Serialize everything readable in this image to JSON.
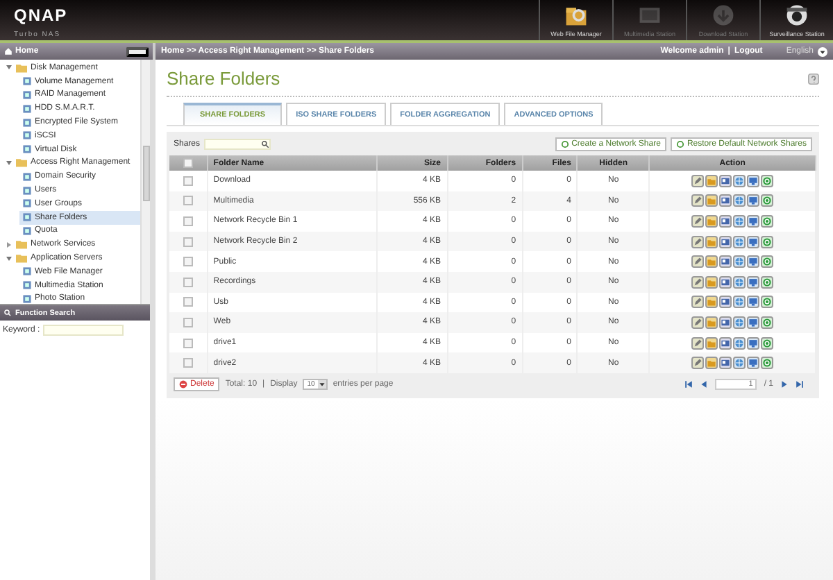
{
  "header": {
    "logo": "QNAP",
    "subtitle": "Turbo NAS",
    "apps": [
      {
        "label": "Web File Manager",
        "kind": "files",
        "disabled": false
      },
      {
        "label": "Multimedia Station",
        "kind": "media",
        "disabled": true
      },
      {
        "label": "Download Station",
        "kind": "download",
        "disabled": true
      },
      {
        "label": "Surveillance Station",
        "kind": "camera",
        "disabled": false
      }
    ]
  },
  "sidebar": {
    "title": "Home",
    "tree": [
      {
        "label": "Disk Management",
        "expanded": true,
        "selected": false,
        "children": [
          {
            "label": "Volume Management",
            "selected": false
          },
          {
            "label": "RAID Management",
            "selected": false
          },
          {
            "label": "HDD S.M.A.R.T.",
            "selected": false
          },
          {
            "label": "Encrypted File System",
            "selected": false
          },
          {
            "label": "iSCSI",
            "selected": false
          },
          {
            "label": "Virtual Disk",
            "selected": false
          }
        ]
      },
      {
        "label": "Access Right Management",
        "expanded": true,
        "selected": false,
        "children": [
          {
            "label": "Domain Security",
            "selected": false
          },
          {
            "label": "Users",
            "selected": false
          },
          {
            "label": "User Groups",
            "selected": false
          },
          {
            "label": "Share Folders",
            "selected": true
          },
          {
            "label": "Quota",
            "selected": false
          }
        ]
      },
      {
        "label": "Network Services",
        "expanded": false,
        "selected": false
      },
      {
        "label": "Application Servers",
        "expanded": true,
        "selected": false,
        "children": [
          {
            "label": "Web File Manager",
            "selected": false
          },
          {
            "label": "Multimedia Station",
            "selected": false
          },
          {
            "label": "Photo Station",
            "selected": false
          }
        ]
      }
    ],
    "search_title": "Function Search",
    "keyword_label": "Keyword :"
  },
  "breadcrumb": "Home >> Access Right Management >> Share Folders",
  "welcome": "Welcome admin",
  "user_separator": "|",
  "logout": "Logout",
  "language": "English",
  "page_title": "Share Folders",
  "tabs": [
    {
      "label": "SHARE FOLDERS",
      "selected": true
    },
    {
      "label": "ISO SHARE FOLDERS",
      "selected": false
    },
    {
      "label": "FOLDER AGGREGATION",
      "selected": false
    },
    {
      "label": "ADVANCED OPTIONS",
      "selected": false
    }
  ],
  "toolbar": {
    "search_label": "Shares",
    "buttons": [
      "Create a Network Share",
      "Restore Default Network Shares"
    ]
  },
  "table": {
    "select_all_checked": false,
    "columns": [
      "Folder Name",
      "Size",
      "Folders",
      "Files",
      "Hidden",
      "Action"
    ],
    "rows": [
      {
        "checked": false,
        "cells": [
          "Download",
          "4 KB",
          "0",
          "0",
          "No"
        ]
      },
      {
        "checked": false,
        "cells": [
          "Multimedia",
          "556 KB",
          "2",
          "4",
          "No"
        ]
      },
      {
        "checked": false,
        "cells": [
          "Network Recycle Bin 1",
          "4 KB",
          "0",
          "0",
          "No"
        ]
      },
      {
        "checked": false,
        "cells": [
          "Network Recycle Bin 2",
          "4 KB",
          "0",
          "0",
          "No"
        ]
      },
      {
        "checked": false,
        "cells": [
          "Public",
          "4 KB",
          "0",
          "0",
          "No"
        ]
      },
      {
        "checked": false,
        "cells": [
          "Recordings",
          "4 KB",
          "0",
          "0",
          "No"
        ]
      },
      {
        "checked": false,
        "cells": [
          "Usb",
          "4 KB",
          "0",
          "0",
          "No"
        ]
      },
      {
        "checked": false,
        "cells": [
          "Web",
          "4 KB",
          "0",
          "0",
          "No"
        ]
      },
      {
        "checked": false,
        "cells": [
          "drive1",
          "4 KB",
          "0",
          "0",
          "No"
        ]
      },
      {
        "checked": false,
        "cells": [
          "drive2",
          "4 KB",
          "0",
          "0",
          "No"
        ]
      }
    ]
  },
  "footer": {
    "delete": "Delete",
    "total": "Total: 10",
    "separator": "|",
    "display": "Display",
    "per_page": "10",
    "entries": "entries per page",
    "page": "1",
    "pages": "/ 1"
  }
}
